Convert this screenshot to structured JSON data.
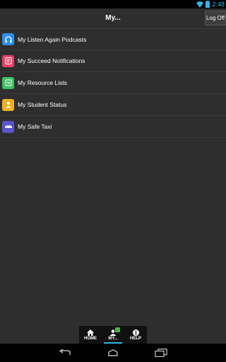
{
  "status_bar": {
    "time": "2:48",
    "time_color": "#33b5e5"
  },
  "header": {
    "title": "My...",
    "logoff_label": "Log Off"
  },
  "menu": {
    "items": [
      {
        "label": "My Listen Again Podcasts",
        "icon": "headphones-icon",
        "color": "#2f8ee8"
      },
      {
        "label": "My Succeed Notifications",
        "icon": "notification-icon",
        "color": "#e8416a"
      },
      {
        "label": "My Resource Lists",
        "icon": "resource-list-icon",
        "color": "#3fbf63"
      },
      {
        "label": "My Student Status",
        "icon": "student-status-icon",
        "color": "#f2b01e"
      },
      {
        "label": "My Safe Taxi",
        "icon": "taxi-icon",
        "color": "#5a55c9"
      }
    ]
  },
  "tabs": {
    "items": [
      {
        "label": "HOME",
        "icon": "home-icon"
      },
      {
        "label": "MY...",
        "icon": "user-icon",
        "active": true
      },
      {
        "label": "HELP",
        "icon": "info-icon"
      }
    ],
    "active_color": "#33b5e5"
  },
  "nav": {
    "buttons": [
      "back-icon",
      "home-nav-icon",
      "recent-apps-icon"
    ]
  }
}
